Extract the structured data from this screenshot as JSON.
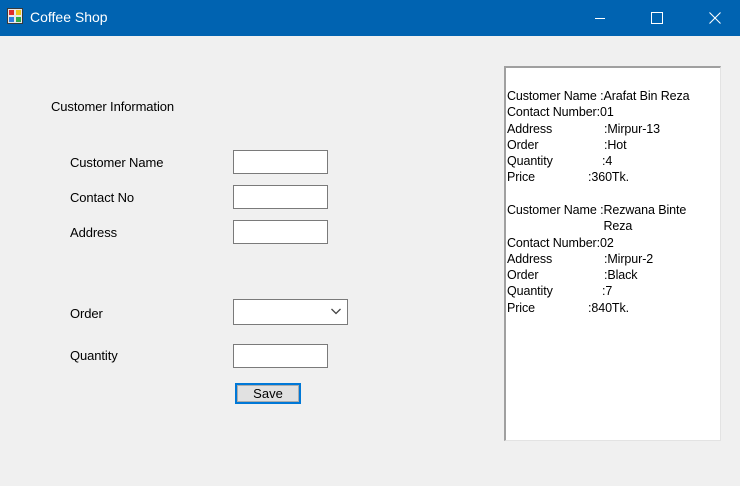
{
  "window": {
    "title": "Coffee Shop",
    "colors": {
      "titlebar": "#0063b1",
      "focus": "#0078d7"
    },
    "controls": {
      "minimize": "minimize-icon",
      "maximize": "maximize-icon",
      "close": "close-icon"
    }
  },
  "form": {
    "section_label": "Customer Information",
    "customer_name_label": "Customer Name",
    "customer_name_value": "",
    "contact_no_label": "Contact No",
    "contact_no_value": "",
    "address_label": "Address",
    "address_value": "",
    "order_label": "Order",
    "order_value": "",
    "quantity_label": "Quantity",
    "quantity_value": "",
    "save_label": "Save"
  },
  "output": {
    "records": [
      {
        "rows": [
          {
            "key": "Customer Name :",
            "value": "Arafat Bin Reza"
          },
          {
            "key": "Contact Number:",
            "value": "01"
          },
          {
            "key": "Address",
            "value": ":Mirpur-13"
          },
          {
            "key": "Order",
            "value": ":Hot"
          },
          {
            "key": "Quantity",
            "value": ":4"
          },
          {
            "key": "Price",
            "value": ":360Tk."
          }
        ]
      },
      {
        "rows": [
          {
            "key": "Customer Name :",
            "value": "Rezwana Binte Reza"
          },
          {
            "key": "Contact Number:",
            "value": "02"
          },
          {
            "key": "Address",
            "value": ":Mirpur-2"
          },
          {
            "key": "Order",
            "value": ":Black"
          },
          {
            "key": "Quantity",
            "value": ":7"
          },
          {
            "key": "Price",
            "value": ":840Tk."
          }
        ]
      }
    ]
  }
}
